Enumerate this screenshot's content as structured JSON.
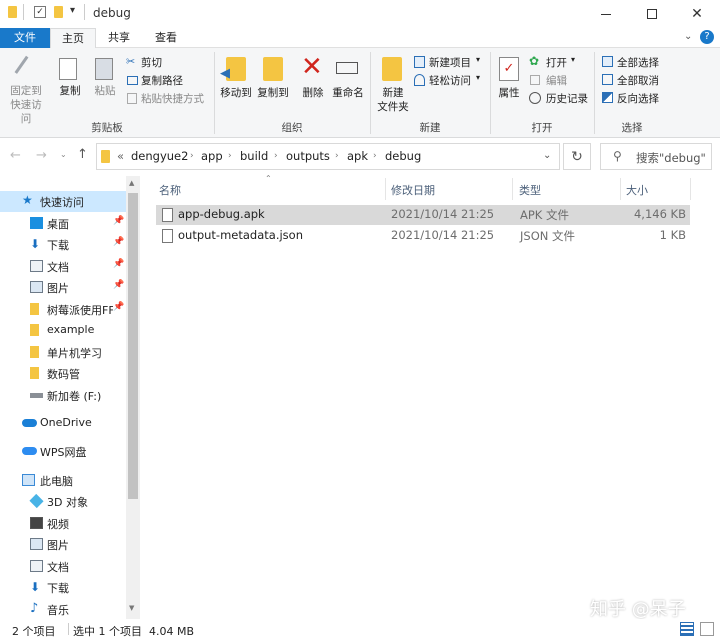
{
  "window": {
    "title": "debug"
  },
  "quick_access_toolbar": {
    "dropdown": "▾"
  },
  "tabs": [
    {
      "label": "文件"
    },
    {
      "label": "主页"
    },
    {
      "label": "共享"
    },
    {
      "label": "查看"
    }
  ],
  "ribbon": {
    "pin": {
      "label1": "固定到",
      "label2": "快速访问"
    },
    "copy": {
      "label": "复制"
    },
    "paste": {
      "label": "粘贴"
    },
    "cut": {
      "label": "剪切"
    },
    "copy_path": {
      "label": "复制路径"
    },
    "paste_shortcut": {
      "label": "粘贴快捷方式"
    },
    "clipboard_group": {
      "label": "剪贴板"
    },
    "move_to": {
      "label": "移动到"
    },
    "copy_to": {
      "label": "复制到"
    },
    "delete": {
      "label": "删除"
    },
    "rename": {
      "label": "重命名"
    },
    "organize_group": {
      "label": "组织"
    },
    "new_folder": {
      "label1": "新建",
      "label2": "文件夹"
    },
    "new_item": {
      "label": "新建项目"
    },
    "easy_access": {
      "label": "轻松访问"
    },
    "new_group": {
      "label": "新建"
    },
    "properties": {
      "label": "属性"
    },
    "open": {
      "label": "打开"
    },
    "edit": {
      "label": "编辑"
    },
    "history": {
      "label": "历史记录"
    },
    "open_group": {
      "label": "打开"
    },
    "select_all": {
      "label": "全部选择"
    },
    "select_none": {
      "label": "全部取消"
    },
    "invert": {
      "label": "反向选择"
    },
    "select_group": {
      "label": "选择"
    }
  },
  "address": {
    "chevrons": "«",
    "crumbs": [
      "dengyue2",
      "app",
      "build",
      "outputs",
      "apk",
      "debug"
    ],
    "search_placeholder": "搜索\"debug\""
  },
  "nav": {
    "quick_access": "快速访问",
    "items": [
      {
        "label": "桌面"
      },
      {
        "label": "下载"
      },
      {
        "label": "文档"
      },
      {
        "label": "图片"
      },
      {
        "label": "树莓派使用FF"
      },
      {
        "label": "example"
      },
      {
        "label": "单片机学习"
      },
      {
        "label": "数码管"
      },
      {
        "label": "新加卷 (F:)"
      }
    ],
    "onedrive": "OneDrive",
    "wps": "WPS网盘",
    "this_pc": "此电脑",
    "pc_items": [
      {
        "label": "3D 对象"
      },
      {
        "label": "视频"
      },
      {
        "label": "图片"
      },
      {
        "label": "文档"
      },
      {
        "label": "下载"
      },
      {
        "label": "音乐"
      }
    ]
  },
  "list": {
    "columns": {
      "name": "名称",
      "date": "修改日期",
      "type": "类型",
      "size": "大小"
    },
    "rows": [
      {
        "name": "app-debug.apk",
        "date": "2021/10/14 21:25",
        "type": "APK 文件",
        "size": "4,146 KB"
      },
      {
        "name": "output-metadata.json",
        "date": "2021/10/14 21:25",
        "type": "JSON 文件",
        "size": "1 KB"
      }
    ]
  },
  "status": {
    "count": "2 个项目",
    "selected": "选中 1 个项目  4.04 MB"
  },
  "watermark": "知乎 @呆子",
  "colors": {
    "accent": "#1979ca",
    "selected_row": "#d9d9d9",
    "folder": "#f4c542"
  }
}
